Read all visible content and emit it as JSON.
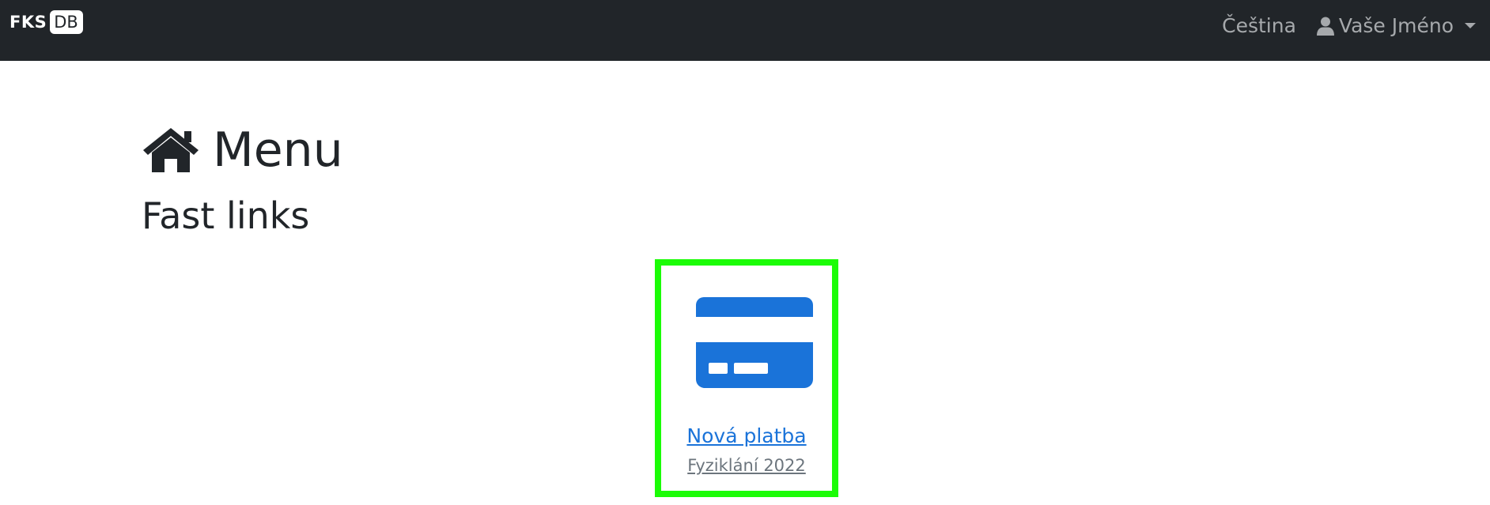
{
  "navbar": {
    "brand_left": "FKS",
    "brand_right": "DB",
    "language": "Čeština",
    "user_name": "Vaše Jméno",
    "user_icon": "user-icon",
    "dropdown_icon": "caret-down-icon"
  },
  "main": {
    "title": "Menu",
    "title_icon": "home-icon",
    "section_title": "Fast links",
    "fast_links": [
      {
        "icon": "credit-card-icon",
        "title": "Nová platba",
        "subtitle": "Fyziklání 2022"
      }
    ]
  },
  "colors": {
    "navbar_bg": "#212529",
    "link": "#1a73d9",
    "card_icon": "#1a73d9",
    "highlight_border": "#1bfc06",
    "muted_text": "#6c757d"
  }
}
